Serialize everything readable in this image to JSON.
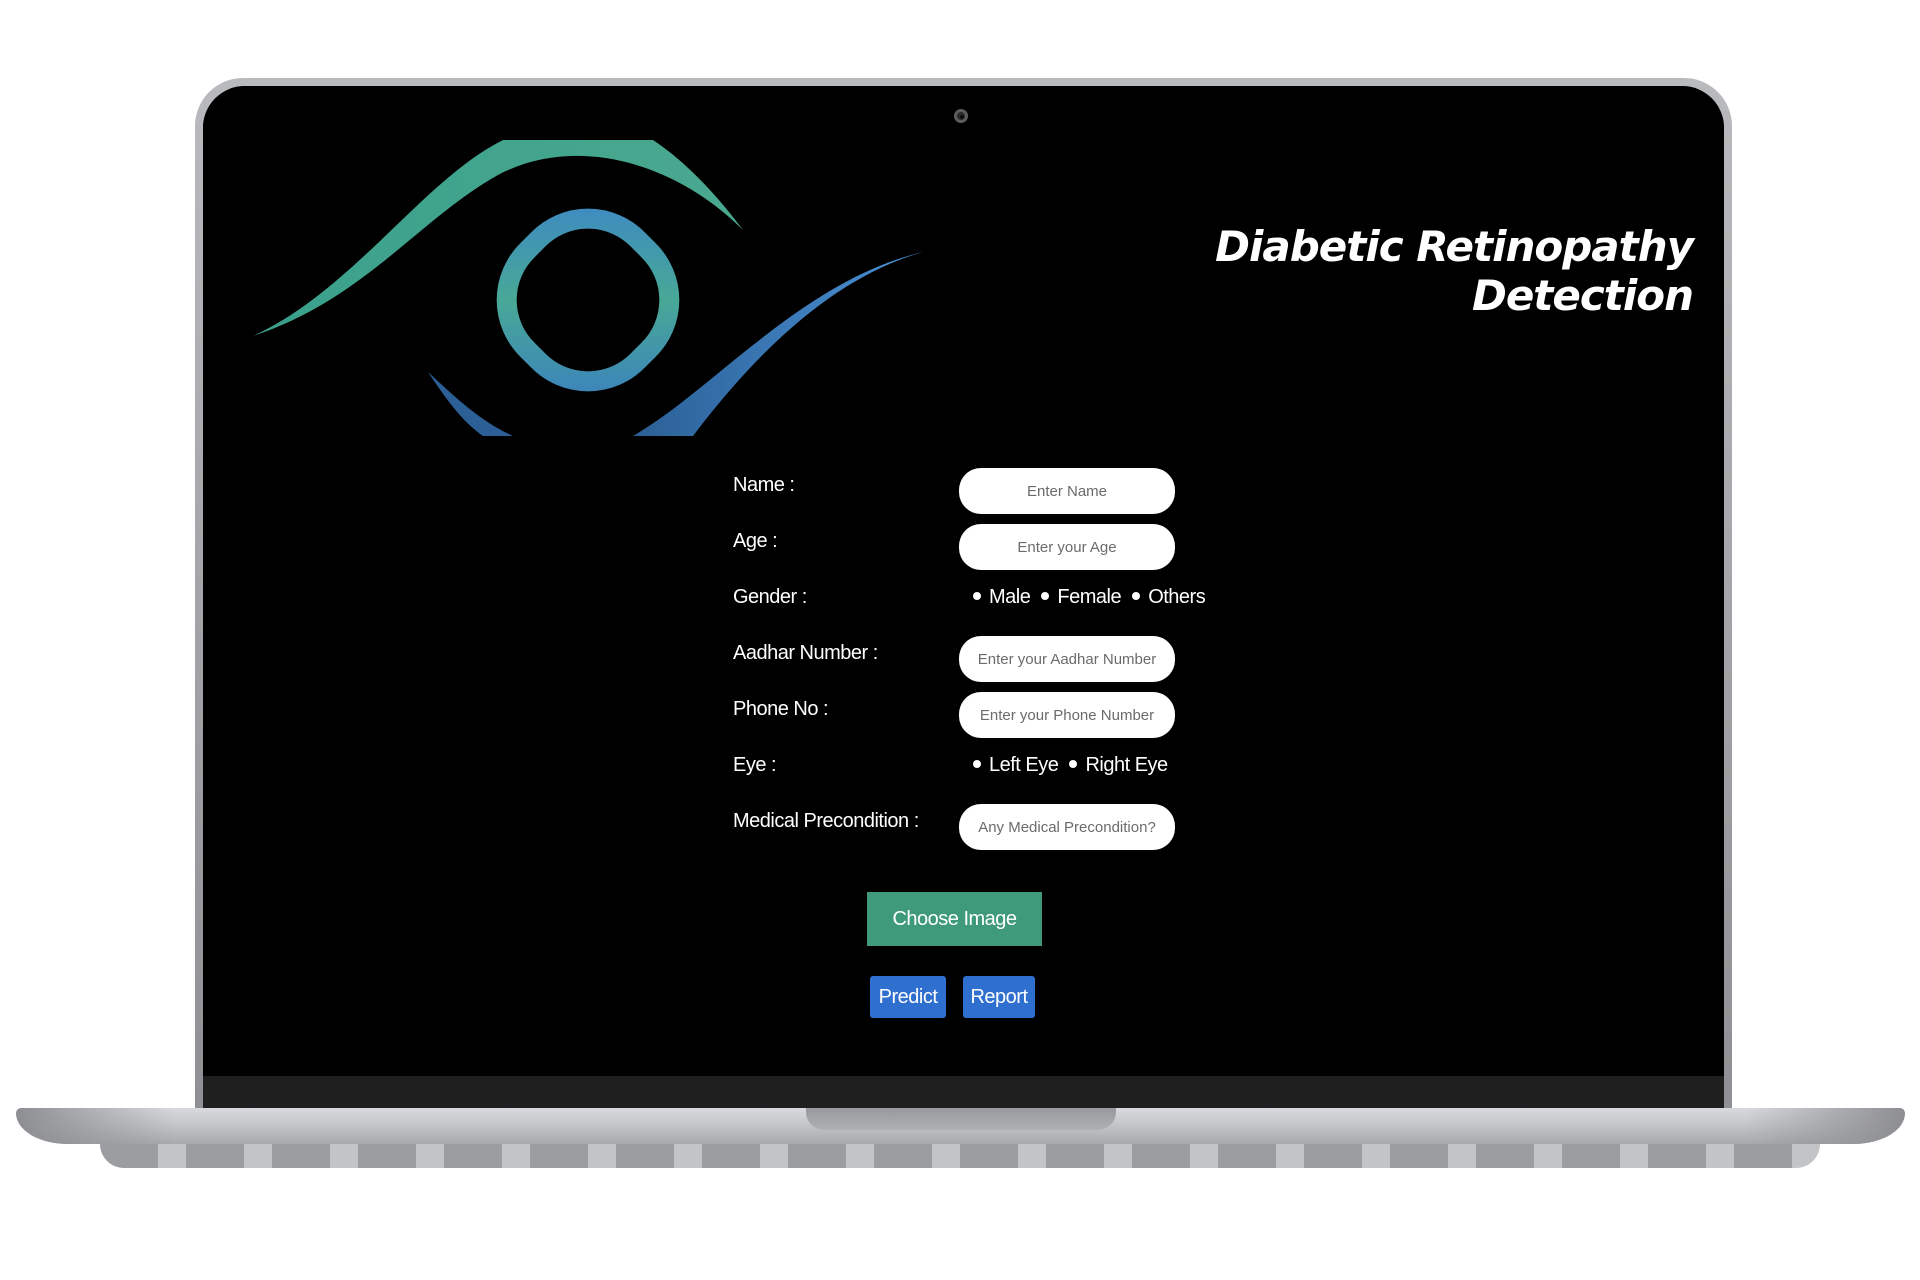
{
  "app": {
    "title": "Diabetic Retinopathy Detection"
  },
  "form": {
    "name": {
      "label": "Name :",
      "placeholder": "Enter Name"
    },
    "age": {
      "label": "Age :",
      "placeholder": "Enter your Age"
    },
    "gender": {
      "label": "Gender :",
      "options": [
        "Male",
        "Female",
        "Others"
      ]
    },
    "aadhar": {
      "label": "Aadhar Number :",
      "placeholder": "Enter your Aadhar Number"
    },
    "phone": {
      "label": "Phone No :",
      "placeholder": "Enter your Phone Number"
    },
    "eye": {
      "label": "Eye :",
      "options": [
        "Left Eye",
        "Right Eye"
      ]
    },
    "precondition": {
      "label": "Medical Precondition :",
      "placeholder": "Any Medical Precondition?"
    }
  },
  "actions": {
    "choose_image": "Choose Image",
    "predict": "Predict",
    "report": "Report"
  },
  "icons": {
    "logo": "eye-logo-icon",
    "camera": "camera-icon"
  },
  "colors": {
    "background": "#000000",
    "choose_button": "#3f9a7c",
    "action_button": "#2f6fd0",
    "logo_teal": "#45a68d",
    "logo_blue": "#3c7fc4"
  }
}
